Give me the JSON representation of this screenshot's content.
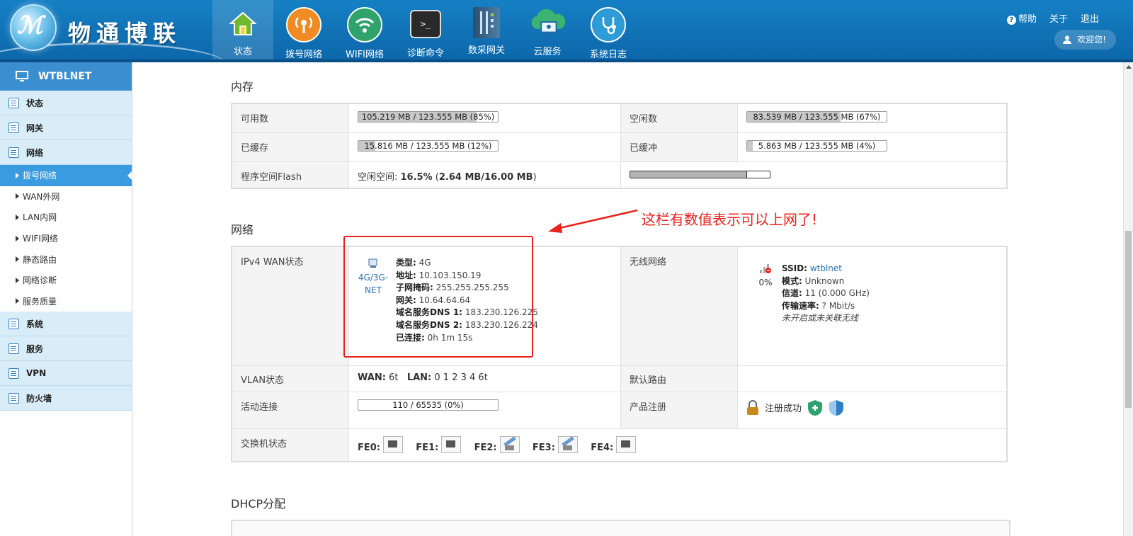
{
  "brand": {
    "logo_text": "ℳ",
    "name": "物通博联"
  },
  "nav": [
    {
      "label": "状态",
      "icon": "home-icon",
      "active": true
    },
    {
      "label": "拨号网络",
      "icon": "dialup-icon"
    },
    {
      "label": "WIFI网络",
      "icon": "wifi-icon"
    },
    {
      "label": "诊断命令",
      "icon": "terminal-icon"
    },
    {
      "label": "数采网关",
      "icon": "gateway-icon"
    },
    {
      "label": "云服务",
      "icon": "cloud-icon"
    },
    {
      "label": "系统日志",
      "icon": "stethoscope-icon"
    }
  ],
  "top_links": {
    "help": "帮助",
    "about": "关于",
    "logout": "退出",
    "welcome": "欢迎您!"
  },
  "sidebar": {
    "title": "WTBLNET",
    "groups": [
      {
        "label": "状态"
      },
      {
        "label": "网关"
      },
      {
        "label": "网络",
        "items": [
          "拨号网络",
          "WAN外网",
          "LAN内网",
          "WIFI网络",
          "静态路由",
          "网络诊断",
          "服务质量"
        ]
      },
      {
        "label": "系统"
      },
      {
        "label": "服务"
      },
      {
        "label": "VPN"
      },
      {
        "label": "防火墙"
      }
    ]
  },
  "memory": {
    "title": "内存",
    "available_label": "可用数",
    "available": "105.219 MB / 123.555 MB (85%)",
    "available_pct": 85,
    "free_label": "空闲数",
    "free": "83.539 MB / 123.555 MB (67%)",
    "free_pct": 67,
    "cached_label": "已缓存",
    "cached": "15.816 MB / 123.555 MB (12%)",
    "cached_pct": 12,
    "buffered_label": "已缓冲",
    "buffered": "5.863 MB / 123.555 MB (4%)",
    "buffered_pct": 4,
    "flash_label": "程序空间Flash",
    "flash_prefix": "空闲空间: ",
    "flash_pct_text": "16.5%",
    "flash_detail": "2.64 MB/16.00 MB",
    "flash_used_fraction": 0.835
  },
  "network": {
    "title": "网络",
    "annotation": "这栏有数值表示可以上网了!",
    "wan_label": "IPv4 WAN状态",
    "wan_iface": "4G/3G-NET",
    "wan": [
      {
        "k": "类型:",
        "v": "4G"
      },
      {
        "k": "地址:",
        "v": "10.103.150.19"
      },
      {
        "k": "子网掩码:",
        "v": "255.255.255.255"
      },
      {
        "k": "网关:",
        "v": "10.64.64.64"
      },
      {
        "k": "域名服务DNS 1:",
        "v": "183.230.126.225"
      },
      {
        "k": "域名服务DNS 2:",
        "v": "183.230.126.224"
      },
      {
        "k": "已连接:",
        "v": "0h 1m 15s"
      }
    ],
    "wireless_label": "无线网络",
    "wireless_pct": "0%",
    "wireless": {
      "ssid_k": "SSID:",
      "ssid_v": "wtblnet",
      "mode_k": "模式:",
      "mode_v": "Unknown",
      "channel_k": "信道:",
      "channel_v": "11 (0.000 GHz)",
      "rate_k": "传输速率:",
      "rate_v": "? Mbit/s",
      "note": "未开启或未关联无线"
    },
    "vlan_label": "VLAN状态",
    "vlan_wan_k": "WAN:",
    "vlan_wan_v": "6t",
    "vlan_lan_k": "LAN:",
    "vlan_lan_v": "0 1 2 3 4 6t",
    "default_route_label": "默认路由",
    "active_conn_label": "活动连接",
    "active_conn": "110 / 65535 (0%)",
    "active_conn_pct": 0,
    "product_reg_label": "产品注册",
    "product_reg": "注册成功",
    "switch_label": "交换机状态",
    "ports": [
      {
        "name": "FE0:",
        "link": false
      },
      {
        "name": "FE1:",
        "link": false
      },
      {
        "name": "FE2:",
        "link": true
      },
      {
        "name": "FE3:",
        "link": true
      },
      {
        "name": "FE4:",
        "link": false
      }
    ]
  },
  "dhcp": {
    "title": "DHCP分配"
  }
}
